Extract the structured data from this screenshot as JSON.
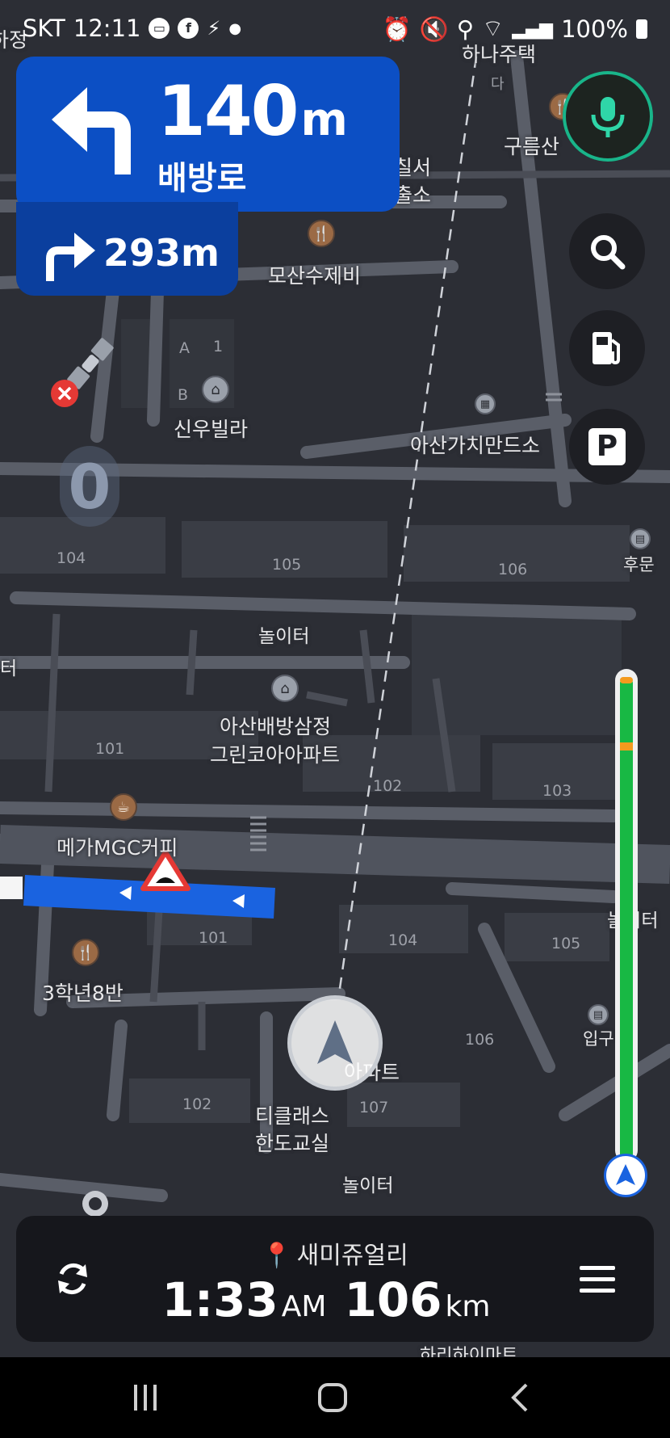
{
  "status_bar": {
    "carrier": "SKT",
    "time": "12:11",
    "left_icons": [
      "car-icon",
      "facebook-icon",
      "app-icon",
      "dot-icon"
    ],
    "right_icons": [
      "alarm-icon",
      "mute-icon",
      "location-icon",
      "wifi-icon",
      "signal-icon",
      "battery-icon"
    ],
    "battery": "100%"
  },
  "guidance": {
    "main_distance": "140",
    "main_unit": "m",
    "main_road": "배방로",
    "main_icon": "turn-left-icon",
    "next_distance": "293m",
    "next_icon": "turn-right-icon"
  },
  "speed": {
    "current": "0"
  },
  "map": {
    "labels": {
      "l1": "하나주택",
      "l2": "구름산",
      "l3": "칠서",
      "l4": "출소",
      "l5": "모산수제비",
      "l6": "신우빌라",
      "l7": "아산가치만드소",
      "l8": "후문",
      "l9": "놀이터",
      "l10": "아산배방삼정",
      "l11": "그린코아아파트",
      "l12": "메가MGC커피",
      "l13": "3학년8반",
      "l14": "티클래스",
      "l15": "한도교실",
      "l16": "놀이터",
      "l17": "입구",
      "l18": "놀이터",
      "l19": "아파트",
      "l20": "하정",
      "l21": "터",
      "l22": "다",
      "l23": "하리하이마트"
    },
    "buildings": {
      "b1": "104",
      "b2": "105",
      "b3": "106",
      "b4": "101",
      "b5": "102",
      "b6": "103",
      "b7": "101",
      "b8": "104",
      "b9": "105",
      "b10": "106",
      "b11": "102",
      "b12": "107",
      "b13": "A",
      "b14": "1",
      "b15": "B"
    }
  },
  "buttons": {
    "mic": "mic-icon",
    "search": "search-icon",
    "fuel": "fuel-icon",
    "parking": "P"
  },
  "route_progress": {
    "remaining_fraction": 0.98
  },
  "bottom_panel": {
    "destination": "새미쥬얼리",
    "eta_time": "1:33",
    "eta_ampm": "AM",
    "remaining_distance": "106",
    "distance_unit": "km"
  },
  "colors": {
    "banner_main": "#0c4fc4",
    "banner_next": "#0b3f9e",
    "route": "#1a63e0",
    "progress": "#18b844",
    "traffic_slow": "#f39a1e",
    "mic_ring": "#19b58a"
  }
}
